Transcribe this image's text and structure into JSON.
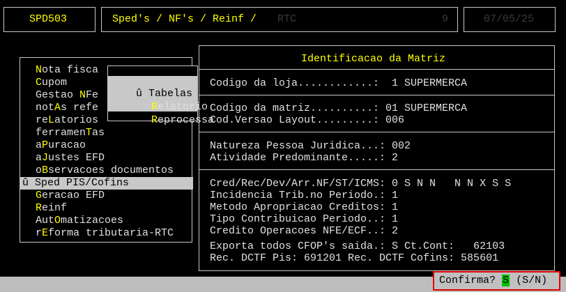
{
  "header": {
    "program_code": "SPD503",
    "breadcrumb": "Sped's / NF's / Reinf /",
    "breadcrumb_dim": "RTC",
    "field_dim": "9",
    "date_dim": "07/05/25"
  },
  "main_menu": {
    "items": [
      {
        "pre": "",
        "hk": "N",
        "post": "ota fisca"
      },
      {
        "pre": "",
        "hk": "C",
        "post": "upom"
      },
      {
        "pre": "Gestao ",
        "hk": "N",
        "post": "Fe"
      },
      {
        "pre": "not",
        "hk": "A",
        "post": "s refe"
      },
      {
        "pre": "re",
        "hk": "L",
        "post": "atorios"
      },
      {
        "pre": "ferramen",
        "hk": "T",
        "post": "as"
      },
      {
        "pre": "a",
        "hk": "P",
        "post": "uracao"
      },
      {
        "pre": "a",
        "hk": "J",
        "post": "ustes EFD"
      },
      {
        "pre": "o",
        "hk": "B",
        "post": "servacoes documentos"
      },
      {
        "pre": "Sped PIS/Cofins",
        "hk": "",
        "post": "",
        "selected": true
      },
      {
        "pre": "",
        "hk": "G",
        "post": "eracao EFD"
      },
      {
        "pre": "",
        "hk": "R",
        "post": "einf"
      },
      {
        "pre": "Aut",
        "hk": "O",
        "post": "matizacoes"
      },
      {
        "pre": "r",
        "hk": "E",
        "post": "forma tributaria-RTC"
      }
    ],
    "selected_marker": "û"
  },
  "submenu": {
    "items": [
      {
        "text": "û Tabelas ba",
        "selected": true
      },
      {
        "text": "Relatorio",
        "hk": "R"
      },
      {
        "text": "Reprocessa",
        "hk": "R"
      }
    ]
  },
  "panel": {
    "title": "Identificacao da Matriz",
    "sections": [
      [
        "Codigo da loja............:  1 SUPERMERCA"
      ],
      [
        "Codigo da matriz..........: 01 SUPERMERCA",
        "Cod.Versao Layout.........: 006"
      ],
      [
        "Natureza Pessoa Juridica...: 002",
        "Atividade Predominante.....: 2"
      ],
      [
        "Cred/Rec/Dev/Arr.NF/ST/ICMS: 0 S N N   N N X S S",
        "Incidencia Trib.no Periodo.: 1",
        "Metodo Apropriacao Creditos: 1",
        "Tipo Contribuicao Periodo..: 1",
        "Credito Operacoes NFE/ECF..: 2",
        "Exporta todos CFOP's saida.: S Ct.Cont:   62103",
        "Rec. DCTF Pis: 691201 Rec. DCTF Cofins: 585601"
      ]
    ]
  },
  "status_bar": {
    "prompt_label": "Confirma?",
    "answer": "S",
    "options": "(S/N)"
  }
}
